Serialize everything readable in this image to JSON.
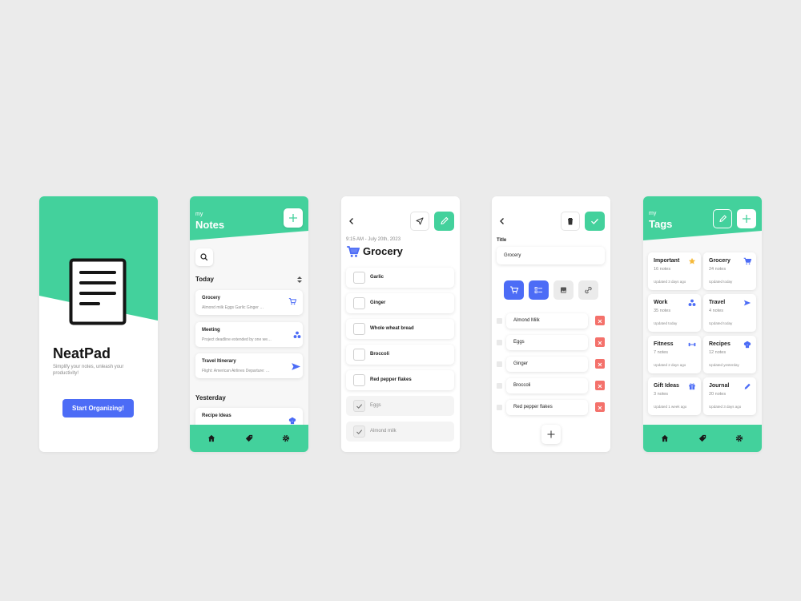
{
  "colors": {
    "accent_green": "#43d19c",
    "accent_blue": "#4c6cf6",
    "danger_red": "#f4716b",
    "star_yellow": "#f5b93a",
    "background": "#ebebeb"
  },
  "splash": {
    "app_name": "NeatPad",
    "tagline_line1": "Simplify your notes, unleash your",
    "tagline_line2": "productivity!",
    "cta_label": "Start Organizing!",
    "logo_icon": "document-icon"
  },
  "notes": {
    "header_small": "my",
    "header_title": "Notes",
    "add_icon": "plus-icon",
    "search_icon": "search-icon",
    "sort_icon": "sort-icon",
    "today_label": "Today",
    "yesterday_label": "Yesterday",
    "today_items": [
      {
        "title": "Grocery",
        "preview": "Almond milk   Eggs   Garlic   Ginger   …",
        "icon": "cart-icon"
      },
      {
        "title": "Meeting",
        "preview": "Project deadline extended by one we…",
        "icon": "people-icon"
      },
      {
        "title": "Travel Itinerary",
        "preview": "Flight: American Airlines    Departure: …",
        "icon": "plane-icon"
      }
    ],
    "yesterday_items": [
      {
        "title": "Recipe Ideas",
        "icon": "chef-hat-icon"
      }
    ],
    "tabs": [
      "home-icon",
      "tag-icon",
      "gear-icon"
    ]
  },
  "detail": {
    "back_icon": "back-chevron-icon",
    "send_icon": "send-icon",
    "edit_icon": "pencil-icon",
    "date": "9:15 AM - July 20th, 2023",
    "title": "Grocery",
    "title_icon": "cart-icon",
    "items": [
      {
        "label": "Garlic",
        "checked": false
      },
      {
        "label": "Ginger",
        "checked": false
      },
      {
        "label": "Whole wheat bread",
        "checked": false
      },
      {
        "label": "Broccoli",
        "checked": false
      },
      {
        "label": "Red pepper flakes",
        "checked": false
      },
      {
        "label": "Eggs",
        "checked": true
      },
      {
        "label": "Almond milk",
        "checked": true
      }
    ]
  },
  "edit": {
    "back_icon": "back-chevron-icon",
    "delete_icon": "trash-icon",
    "confirm_icon": "check-icon",
    "title_label": "Title",
    "title_value": "Grocery",
    "tag_icons": [
      "cart-icon",
      "checklist-icon",
      "image-icon",
      "link-icon"
    ],
    "items": [
      "Almond Milk",
      "Eggs",
      "Ginger",
      "Broccoli",
      "Red pepper flakes"
    ],
    "remove_icon": "close-icon",
    "add_icon": "plus-icon"
  },
  "tags": {
    "header_small": "my",
    "header_title": "Tags",
    "edit_icon": "pencil-icon",
    "add_icon": "plus-icon",
    "items": [
      {
        "name": "Important",
        "count": "16 notes",
        "updated": "Updated 3 days ago",
        "icon": "star-icon"
      },
      {
        "name": "Grocery",
        "count": "24 notes",
        "updated": "Updated today",
        "icon": "cart-icon"
      },
      {
        "name": "Work",
        "count": "35 notes",
        "updated": "Updated today",
        "icon": "people-icon"
      },
      {
        "name": "Travel",
        "count": "4 notes",
        "updated": "Updated today",
        "icon": "plane-icon"
      },
      {
        "name": "Fitness",
        "count": "7 notes",
        "updated": "Updated 2 days ago",
        "icon": "dumbbell-icon"
      },
      {
        "name": "Recipes",
        "count": "12 notes",
        "updated": "Updated yesterday",
        "icon": "chef-hat-icon"
      },
      {
        "name": "Gift Ideas",
        "count": "3 notes",
        "updated": "Updated 1 week ago",
        "icon": "gift-icon"
      },
      {
        "name": "Journal",
        "count": "20 notes",
        "updated": "Updated 3 days ago",
        "icon": "pen-icon"
      }
    ],
    "tabs": [
      "home-icon",
      "tag-icon",
      "gear-icon"
    ]
  }
}
